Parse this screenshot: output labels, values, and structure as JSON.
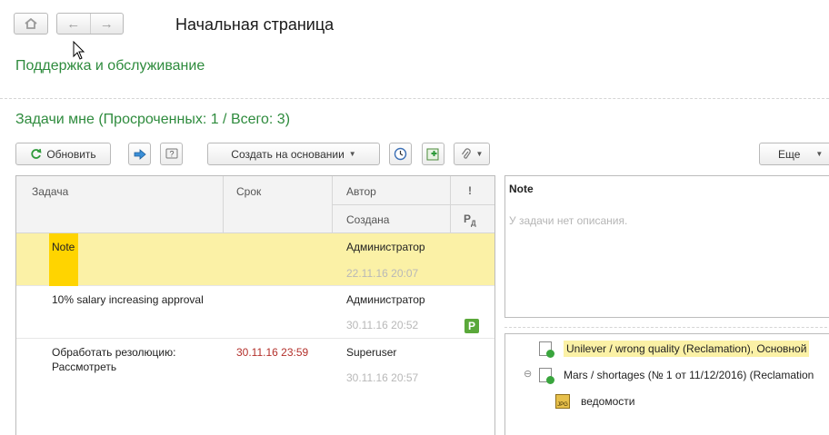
{
  "header": {
    "title": "Начальная страница",
    "section": "Поддержка и обслуживание"
  },
  "tasks": {
    "title": "Задачи мне (Просроченных: 1 / Всего: 3)"
  },
  "toolbar": {
    "refresh_label": "Обновить",
    "create_label": "Создать на основании",
    "more_label": "Еще"
  },
  "grid": {
    "columns": {
      "task": "Задача",
      "due": "Срок",
      "author": "Автор",
      "created": "Создана",
      "importance": "!",
      "p": "Р",
      "d": "Д"
    },
    "rows": [
      {
        "task": "Note",
        "due": "",
        "author": "Администратор",
        "created": "22.11.16 20:07",
        "selected": true
      },
      {
        "task": "10% salary increasing approval",
        "due": "",
        "author": "Администратор",
        "created": "30.11.16 20:52",
        "badge": "P"
      },
      {
        "task": "Обработать резолюцию:",
        "task_line2": "Рассмотреть",
        "due": "30.11.16 23:59",
        "author": "Superuser",
        "created": "30.11.16 20:57"
      }
    ]
  },
  "description": {
    "title": "Note",
    "empty_text": "У задачи нет описания."
  },
  "objects": {
    "items": [
      {
        "label": "Unilever / wrong quality (Reclamation), Основной",
        "icon": "doc-check-icon"
      },
      {
        "label": "Mars / shortages (№ 1 от 11/12/2016) (Reclamation",
        "icon": "doc-check-icon",
        "collapse": "⊖"
      },
      {
        "label": "ведомости",
        "icon": "jpg-file-icon",
        "icon_text": "JPG"
      }
    ]
  },
  "colors": {
    "accent_green": "#2e8b3d",
    "selection_yellow": "#fbf1a6",
    "marker_yellow": "#ffd400",
    "overdue_red": "#b3302b"
  }
}
